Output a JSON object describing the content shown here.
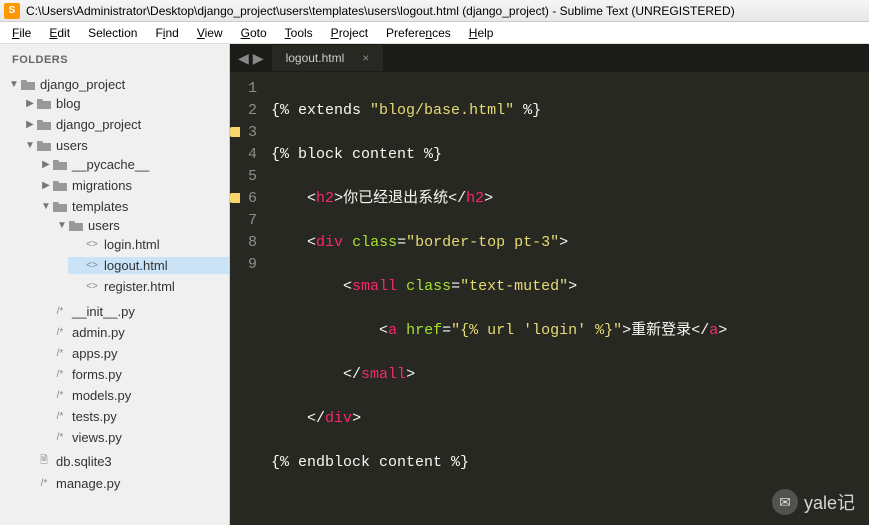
{
  "window": {
    "title": "C:\\Users\\Administrator\\Desktop\\django_project\\users\\templates\\users\\logout.html (django_project) - Sublime Text (UNREGISTERED)"
  },
  "menu": {
    "file": "File",
    "edit": "Edit",
    "selection": "Selection",
    "find": "Find",
    "view": "View",
    "goto": "Goto",
    "tools": "Tools",
    "project": "Project",
    "preferences": "Preferences",
    "help": "Help"
  },
  "sidebar": {
    "header": "FOLDERS",
    "tree": {
      "root": "django_project",
      "blog": "blog",
      "django_project": "django_project",
      "users": "users",
      "pycache": "__pycache__",
      "migrations": "migrations",
      "templates": "templates",
      "users_inner": "users",
      "login": "login.html",
      "logout": "logout.html",
      "register": "register.html",
      "init": "__init__.py",
      "admin": "admin.py",
      "apps": "apps.py",
      "forms": "forms.py",
      "models": "models.py",
      "tests": "tests.py",
      "views": "views.py",
      "dbsqlite": "db.sqlite3",
      "manage": "manage.py"
    }
  },
  "tab": {
    "name": "logout.html"
  },
  "code": {
    "lines": [
      "1",
      "2",
      "3",
      "4",
      "5",
      "6",
      "7",
      "8",
      "9"
    ],
    "l1a": "{% extends ",
    "l1b": "\"blog/base.html\"",
    "l1c": " %}",
    "l2": "{% block content %}",
    "l3_open": "<",
    "l3_tag": "h2",
    "l3_close": ">",
    "l3_text": "你已经退出系统",
    "l3_eopen": "</",
    "l3_etag": "h2",
    "l3_eclose": ">",
    "l4_open": "<",
    "l4_tag": "div",
    "l4_sp": " ",
    "l4_attr": "class",
    "l4_eq": "=",
    "l4_val": "\"border-top pt-3\"",
    "l4_close": ">",
    "l5_open": "<",
    "l5_tag": "small",
    "l5_sp": " ",
    "l5_attr": "class",
    "l5_eq": "=",
    "l5_val": "\"text-muted\"",
    "l5_close": ">",
    "l6_open": "<",
    "l6_tag": "a",
    "l6_sp": " ",
    "l6_attr": "href",
    "l6_eq": "=",
    "l6_val": "\"{% url 'login' %}\"",
    "l6_close": ">",
    "l6_text": "重新登录",
    "l6_eopen": "</",
    "l6_etag": "a",
    "l6_eclose": ">",
    "l7_open": "</",
    "l7_tag": "small",
    "l7_close": ">",
    "l8_open": "</",
    "l8_tag": "div",
    "l8_close": ">",
    "l9": "{% endblock content %}"
  },
  "watermark": {
    "text": "yale记"
  }
}
